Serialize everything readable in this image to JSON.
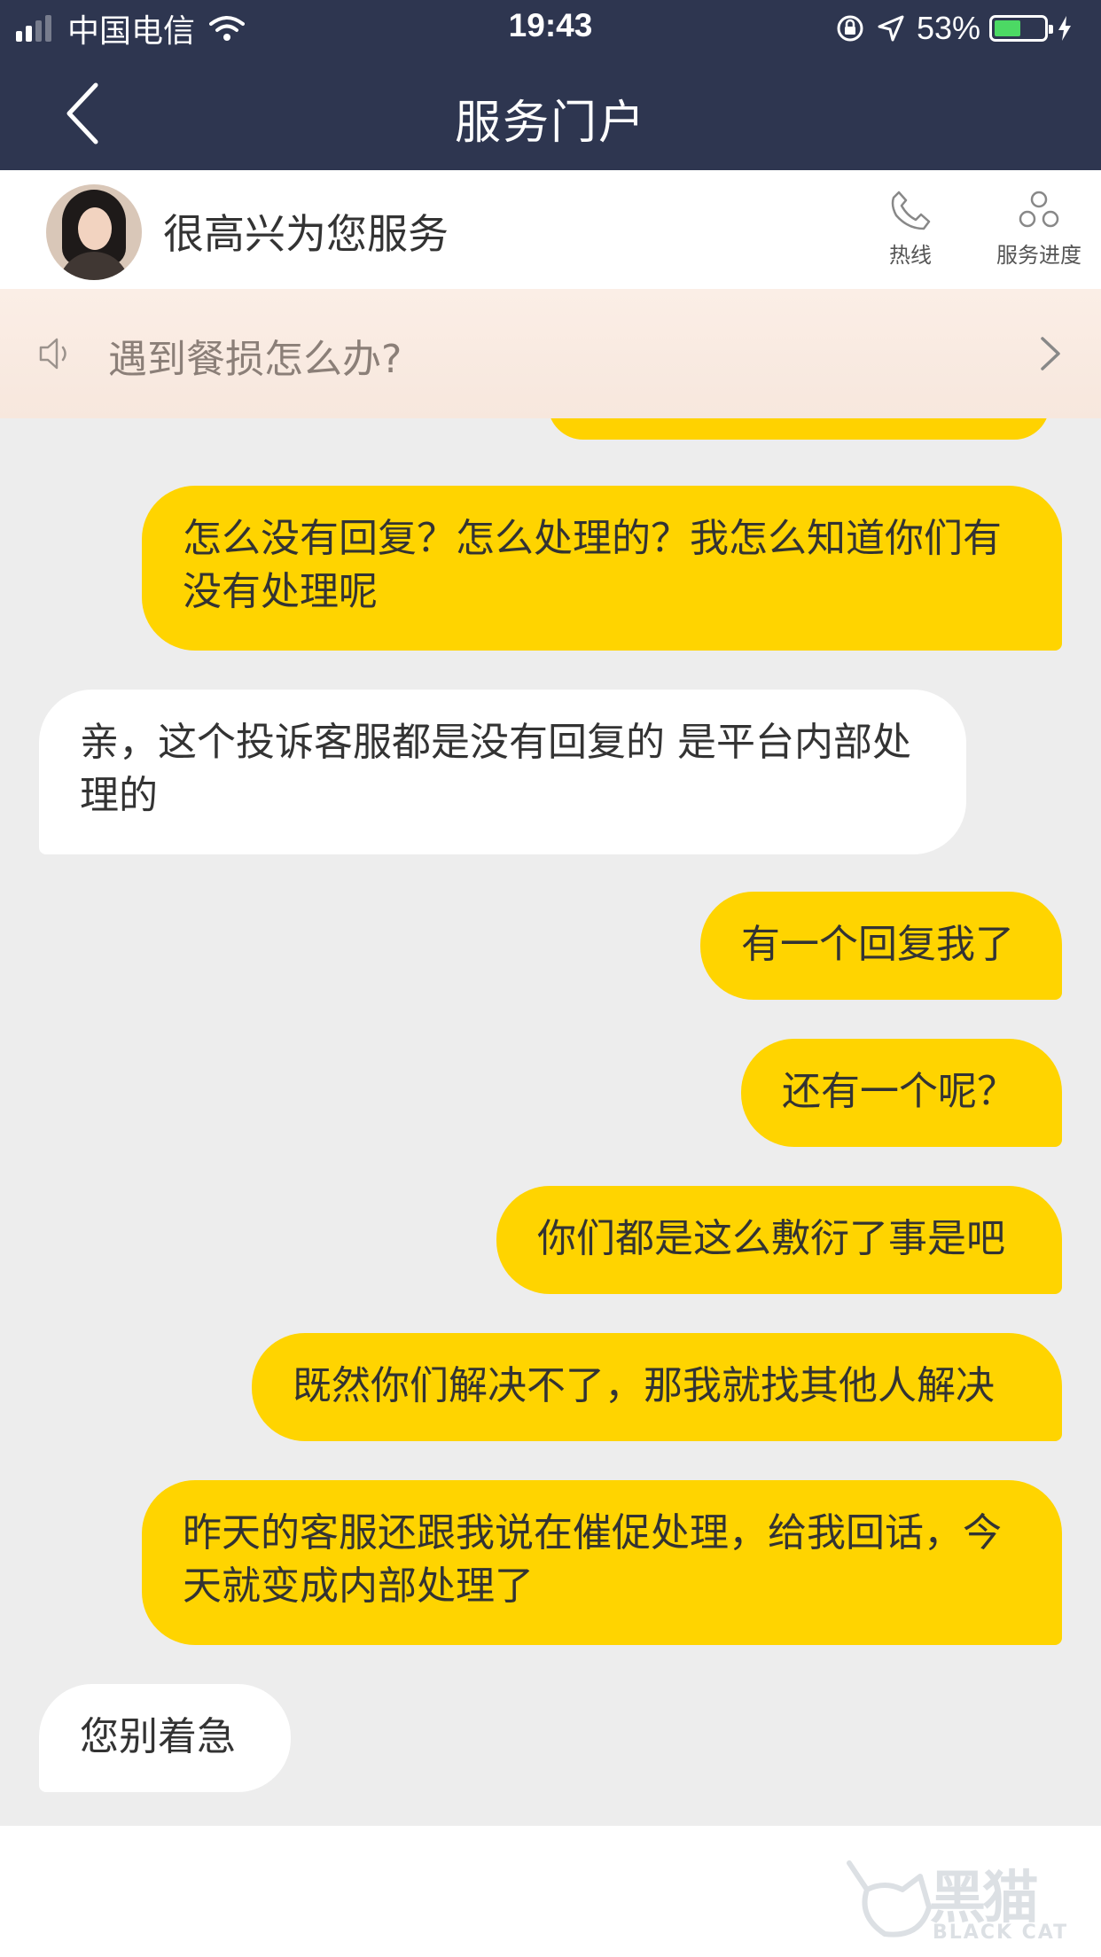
{
  "status_bar": {
    "carrier": "中国电信",
    "time": "19:43",
    "battery_percent": "53%",
    "battery_level": 0.53,
    "icons": [
      "signal-icon",
      "wifi-icon",
      "orientation-lock-icon",
      "location-icon",
      "battery-icon",
      "charging-icon"
    ]
  },
  "nav": {
    "title": "服务门户",
    "back_icon": "chevron-left-icon"
  },
  "agent": {
    "greeting": "很高兴为您服务",
    "hotline_label": "热线",
    "progress_label": "服务进度"
  },
  "notice": {
    "text": "遇到餐损怎么办?",
    "icon": "speaker-icon"
  },
  "messages": [
    {
      "from": "user",
      "text": "怎么没有回复？怎么处理的？我怎么知道你们有没有处理呢"
    },
    {
      "from": "agent",
      "text": "亲，这个投诉客服都是没有回复的 是平台内部处理的"
    },
    {
      "from": "user",
      "text": "有一个回复我了"
    },
    {
      "from": "user",
      "text": "还有一个呢？"
    },
    {
      "from": "user",
      "text": "你们都是这么敷衍了事是吧"
    },
    {
      "from": "user",
      "text": "既然你们解决不了，那我就找其他人解决"
    },
    {
      "from": "user",
      "text": "昨天的客服还跟我说在催促处理，给我回话，今天就变成内部处理了"
    },
    {
      "from": "agent",
      "text": "您别着急"
    }
  ],
  "watermark": {
    "title": "黑猫",
    "subtitle": "BLACK CAT"
  },
  "colors": {
    "nav_bg": "#2e3650",
    "user_bubble": "#ffd400",
    "agent_bubble": "#ffffff",
    "chat_bg": "#ededed",
    "notice_bg": "#f9ebe2"
  }
}
